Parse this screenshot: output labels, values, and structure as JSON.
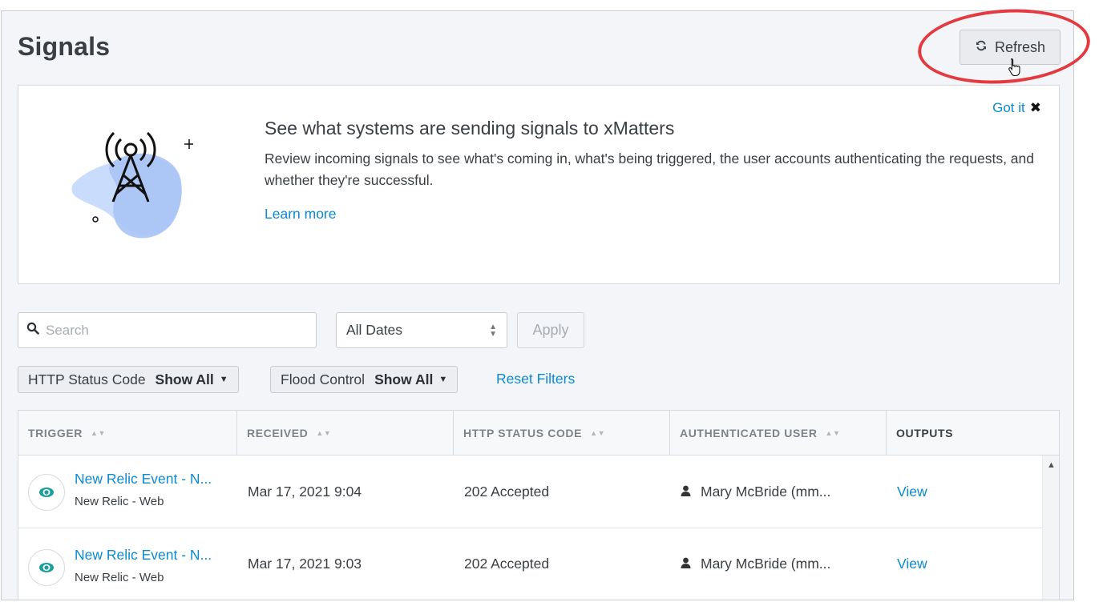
{
  "page": {
    "title": "Signals"
  },
  "toolbar": {
    "refresh_label": "Refresh"
  },
  "banner": {
    "dismiss_label": "Got it",
    "heading": "See what systems are sending signals to xMatters",
    "body": "Review incoming signals to see what's coming in, what's being triggered, the user accounts authenticating the requests, and whether they're successful.",
    "learn_more": "Learn more"
  },
  "filters": {
    "search_placeholder": "Search",
    "search_value": "",
    "dates_selected": "All Dates",
    "apply_label": "Apply",
    "http_status": {
      "label": "HTTP Status Code",
      "value": "Show All"
    },
    "flood_control": {
      "label": "Flood Control",
      "value": "Show All"
    },
    "reset_label": "Reset Filters"
  },
  "table": {
    "columns": [
      "TRIGGER",
      "RECEIVED",
      "HTTP STATUS CODE",
      "AUTHENTICATED USER",
      "OUTPUTS"
    ],
    "rows": [
      {
        "trigger": "New Relic Event - N...",
        "source": "New Relic - Web",
        "received": "Mar 17, 2021 9:04",
        "status": "202 Accepted",
        "user": "Mary McBride (mm...",
        "output": "View"
      },
      {
        "trigger": "New Relic Event - N...",
        "source": "New Relic - Web",
        "received": "Mar 17, 2021 9:03",
        "status": "202 Accepted",
        "user": "Mary McBride (mm...",
        "output": "View"
      }
    ]
  },
  "colors": {
    "link": "#0a8ad0",
    "annotation": "#e23a3f",
    "page_bg": "#f3f5f8",
    "trigger_icon": "#1a9e9e"
  },
  "icons": [
    "refresh-icon",
    "pointer-cursor-icon",
    "close-icon",
    "signal-tower-icon",
    "search-icon",
    "sort-icon",
    "user-icon",
    "trigger-eye-icon",
    "scroll-up-icon"
  ]
}
